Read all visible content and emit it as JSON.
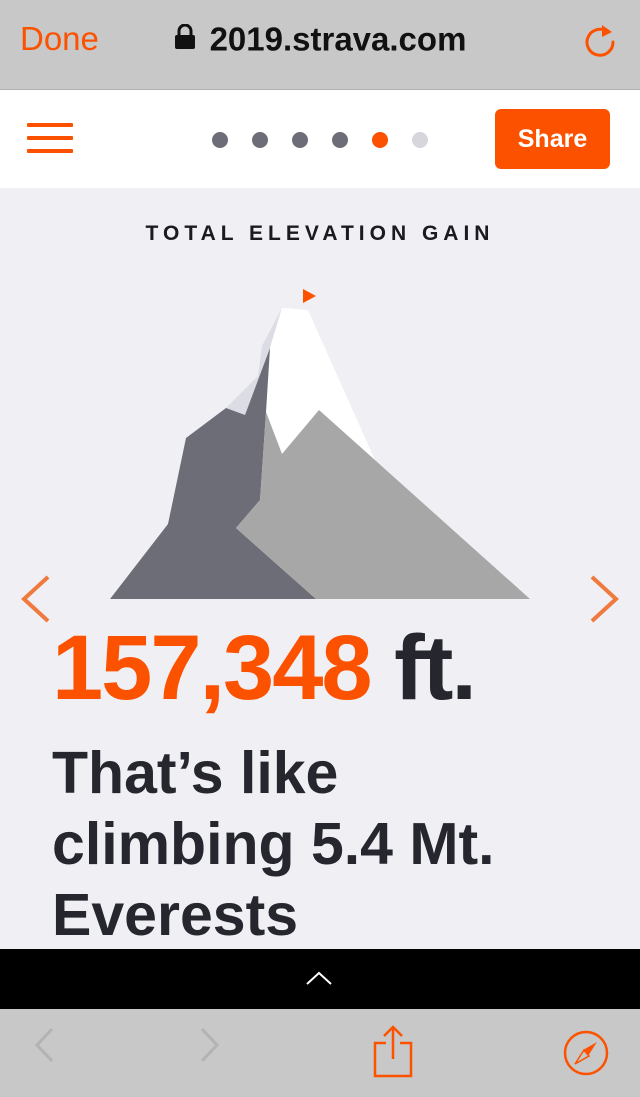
{
  "browser": {
    "done_label": "Done",
    "url": "2019.strava.com",
    "icons": [
      "lock-icon",
      "reload-icon"
    ]
  },
  "header": {
    "menu_icon": "hamburger-icon",
    "pager": {
      "total": 6,
      "active_index": 4
    },
    "share_label": "Share"
  },
  "slide": {
    "title": "TOTAL ELEVATION GAIN",
    "stat_value": "157,348",
    "stat_unit": "ft.",
    "headline_line1": "That’s like",
    "headline_line2": "climbing 5.4 Mt.",
    "headline_line3": "Everests"
  },
  "toolbar": {
    "icons": [
      "back-icon",
      "forward-icon",
      "share-icon",
      "compass-icon"
    ]
  },
  "colors": {
    "accent": "#fc5200",
    "text_dark": "#26262e",
    "bg": "#efeff4",
    "chrome": "#c8c8c8"
  }
}
